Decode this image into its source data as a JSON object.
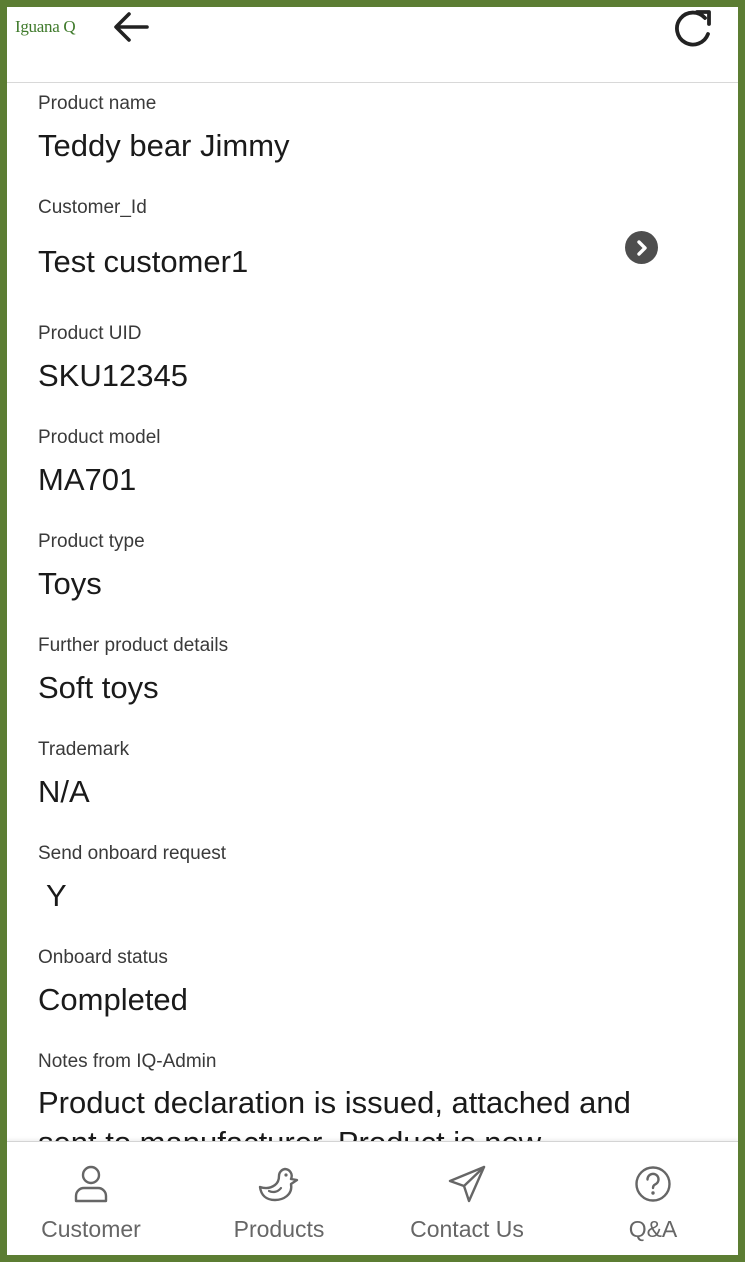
{
  "header": {
    "logo_text": "Iguana Q",
    "back_icon": "arrow-left-icon",
    "refresh_icon": "refresh-icon"
  },
  "fields": {
    "product_name": {
      "label": "Product name",
      "value": "Teddy bear Jimmy"
    },
    "customer_id": {
      "label": "Customer_Id",
      "value": "Test customer1"
    },
    "product_uid": {
      "label": "Product UID",
      "value": "SKU12345"
    },
    "product_model": {
      "label": "Product model",
      "value": "MA701"
    },
    "product_type": {
      "label": "Product type",
      "value": "Toys"
    },
    "further_details": {
      "label": "Further product details",
      "value": "Soft toys"
    },
    "trademark": {
      "label": "Trademark",
      "value": "N/A"
    },
    "send_onboard": {
      "label": "Send onboard request",
      "value": "Y"
    },
    "onboard_status": {
      "label": "Onboard status",
      "value": "Completed"
    },
    "notes": {
      "label": "Notes from IQ-Admin",
      "value": "Product declaration is issued, attached and sent to manufacturer. Product is now"
    }
  },
  "nav": {
    "items": [
      {
        "label": "Customer",
        "icon": "person-icon"
      },
      {
        "label": "Products",
        "icon": "duck-icon"
      },
      {
        "label": "Contact Us",
        "icon": "paper-plane-icon"
      },
      {
        "label": "Q&A",
        "icon": "question-circle-icon"
      }
    ]
  },
  "colors": {
    "frame": "#5c7d33",
    "logo": "#3f7a2b",
    "nav_text": "#666666",
    "chevron_bg": "#4e4e4e"
  }
}
